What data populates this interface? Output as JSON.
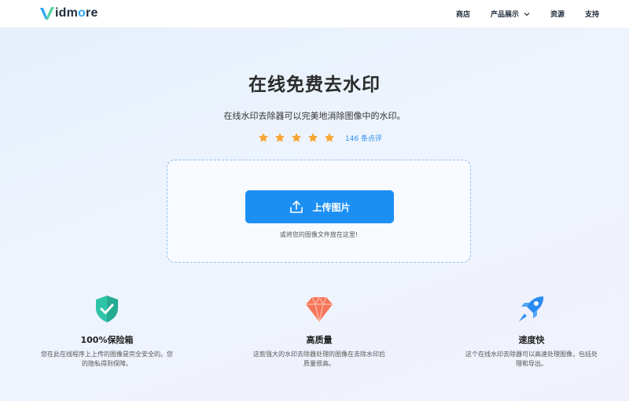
{
  "header": {
    "logo_text_prefix": "idm",
    "logo_text_o": "o",
    "logo_text_suffix": "re",
    "nav": [
      {
        "label": "商店"
      },
      {
        "label": "产品展示"
      },
      {
        "label": "资源"
      },
      {
        "label": "支持"
      }
    ]
  },
  "hero": {
    "title": "在线免费去水印",
    "subtitle": "在线水印去除器可以完美地消除图像中的水印。",
    "rating": {
      "stars": 5,
      "reviews_label": "146 条点评"
    }
  },
  "upload": {
    "button_label": "上传图片",
    "hint": "或将您的图像文件放在这里!"
  },
  "features": [
    {
      "icon": "shield-check-icon",
      "name": "100%保险箱",
      "desc": "您在此在线程序上上传的图像是完全安全的。您的隐私得到保障。"
    },
    {
      "icon": "diamond-icon",
      "name": "高质量",
      "desc": "这款强大的水印去除器处理的图像在去除水印后质量很高。"
    },
    {
      "icon": "rocket-icon",
      "name": "速度快",
      "desc": "这个在线水印去除器可以高速处理图像，包括处理和导出。"
    }
  ],
  "colors": {
    "accent": "#1c8ff5",
    "star": "#f7a534",
    "shield": "#2ec4a8",
    "diamond": "#f7755a",
    "rocket": "#2a8bf2"
  }
}
